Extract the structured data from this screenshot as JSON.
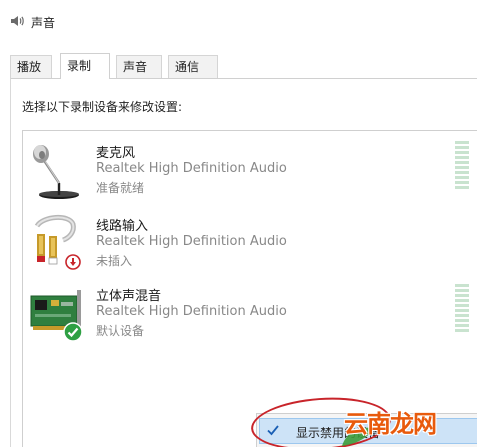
{
  "window": {
    "title": "声音"
  },
  "tabs": [
    {
      "label": "播放",
      "active": false
    },
    {
      "label": "录制",
      "active": true
    },
    {
      "label": "声音",
      "active": false
    },
    {
      "label": "通信",
      "active": false
    }
  ],
  "recording": {
    "instruction": "选择以下录制设备来修改设置:",
    "devices": [
      {
        "name": "麦克风",
        "driver": "Realtek High Definition Audio",
        "status": "准备就绪",
        "icon": "microphone-icon"
      },
      {
        "name": "线路输入",
        "driver": "Realtek High Definition Audio",
        "status": "未插入",
        "icon": "line-in-cable-icon",
        "badge": "unplugged-badge-icon"
      },
      {
        "name": "立体声混音",
        "driver": "Realtek High Definition Audio",
        "status": "默认设备",
        "icon": "sound-card-icon",
        "badge": "default-device-check-icon"
      }
    ]
  },
  "context_menu": {
    "items": [
      {
        "label": "显示禁用的设备",
        "checked": true
      }
    ]
  },
  "watermark": {
    "text": "云南龙网"
  },
  "colors": {
    "accent_highlight": "#cde3f7",
    "annotation_red": "#c8242a",
    "watermark_orange": "#e85a0c",
    "level_meter": "#c9e3cf"
  }
}
